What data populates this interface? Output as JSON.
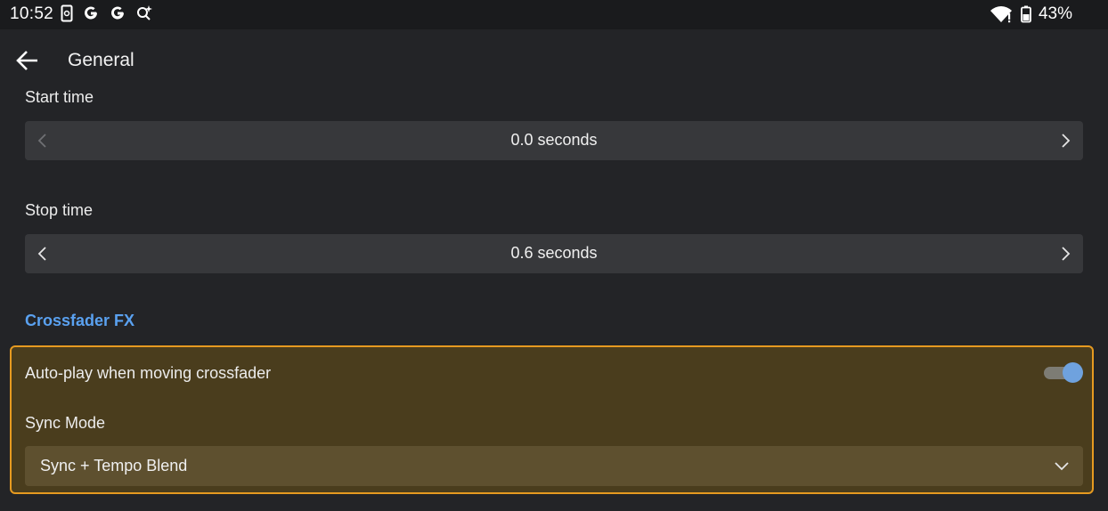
{
  "status_bar": {
    "time": "10:52",
    "battery_percent": "43%",
    "icons_left": [
      "screenshot-icon",
      "google-icon",
      "google-icon",
      "search-sparkle-icon"
    ],
    "icons_right": [
      "wifi-icon",
      "battery-icon"
    ]
  },
  "app_bar": {
    "title": "General"
  },
  "settings": {
    "start_time": {
      "label": "Start time",
      "value": "0.0 seconds"
    },
    "stop_time": {
      "label": "Stop time",
      "value": "0.6 seconds"
    },
    "crossfader_section": {
      "header": "Crossfader FX",
      "auto_play": {
        "label": "Auto-play when moving crossfader",
        "enabled": true
      },
      "sync_mode": {
        "label": "Sync Mode",
        "selected": "Sync + Tempo Blend"
      }
    }
  },
  "colors": {
    "background": "#232427",
    "accent": "#5aa1f0",
    "highlight_border": "#e69a20",
    "highlight_fill": "#4a3d1d",
    "toggle_thumb": "#6fa2de"
  }
}
